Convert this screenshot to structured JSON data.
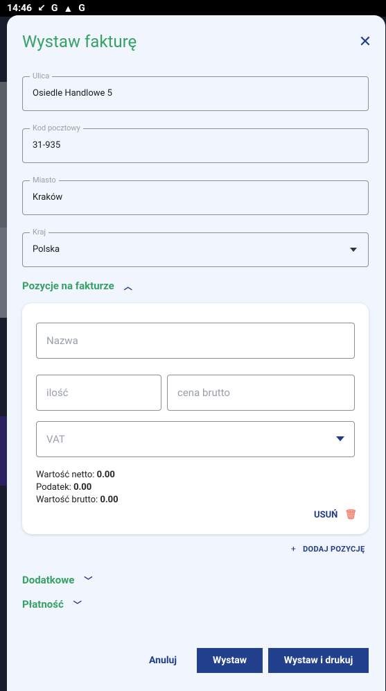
{
  "status_bar": {
    "time": "14:46",
    "icons": [
      "missed-call-icon",
      "google-icon",
      "photos-icon",
      "google-icon"
    ]
  },
  "dialog": {
    "title": "Wystaw fakturę",
    "close_icon": "close-icon"
  },
  "address": {
    "street": {
      "label": "Ulica",
      "value": "Osiedle Handlowe 5"
    },
    "postal_code": {
      "label": "Kod pocztowy",
      "value": "31-935"
    },
    "city": {
      "label": "Miasto",
      "value": "Kraków"
    },
    "country": {
      "label": "Kraj",
      "value": "Polska"
    }
  },
  "items_section": {
    "title": "Pozycje na fakturze",
    "expanded": true,
    "item": {
      "name_placeholder": "Nazwa",
      "quantity_placeholder": "ilość",
      "gross_price_placeholder": "cena brutto",
      "vat_placeholder": "VAT",
      "net_label": "Wartość netto:",
      "net_value": "0.00",
      "tax_label": "Podatek:",
      "tax_value": "0.00",
      "gross_label": "Wartość brutto:",
      "gross_value": "0.00",
      "delete_label": "USUŃ"
    },
    "add_item_label": "DODAJ POZYCJĘ"
  },
  "additional_section": {
    "title": "Dodatkowe",
    "expanded": false
  },
  "payment_section": {
    "title": "Płatność",
    "expanded": false
  },
  "actions": {
    "cancel": "Anuluj",
    "issue": "Wystaw",
    "issue_print": "Wystaw i drukuj"
  },
  "colors": {
    "accent_green": "#35a265",
    "primary_blue": "#22408c",
    "sheet_bg": "#f1f5fd",
    "delete_icon": "#f08a7a"
  }
}
